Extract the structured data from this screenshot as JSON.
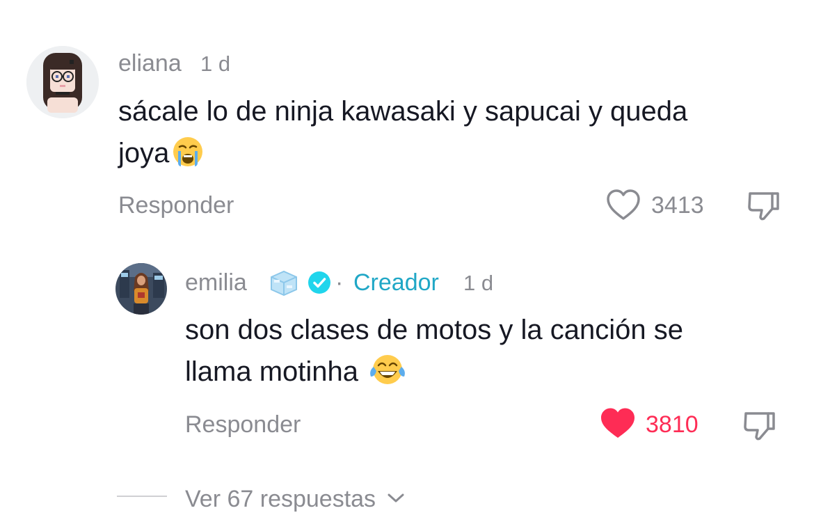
{
  "comment": {
    "username": "eliana",
    "time": "1 d",
    "text": "sácale lo de ninja kawasaki y sapucai y queda joya",
    "text_line1": "sácale lo de ninja kawasaki y sapucai y queda",
    "text_line2": "joya",
    "emoji": "loudly-crying-face",
    "reply_label": "Responder",
    "likes": "3413",
    "liked": false
  },
  "reply": {
    "username": "emilia",
    "badge_emoji": "ice-cube",
    "verified": true,
    "separator": "·",
    "creator_label": "Creador",
    "time": "1 d",
    "text_line1": "son dos clases de motos y la canción se",
    "text_line2": "llama motinha",
    "emoji": "face-with-tears-of-joy",
    "reply_label": "Responder",
    "likes": "3810",
    "liked": true
  },
  "more_replies": {
    "label": "Ver 67 respuestas"
  },
  "colors": {
    "muted": "#8a8b91",
    "text": "#161823",
    "creator": "#20a7c6",
    "liked": "#fe2c55",
    "verified": "#20d5ec"
  }
}
